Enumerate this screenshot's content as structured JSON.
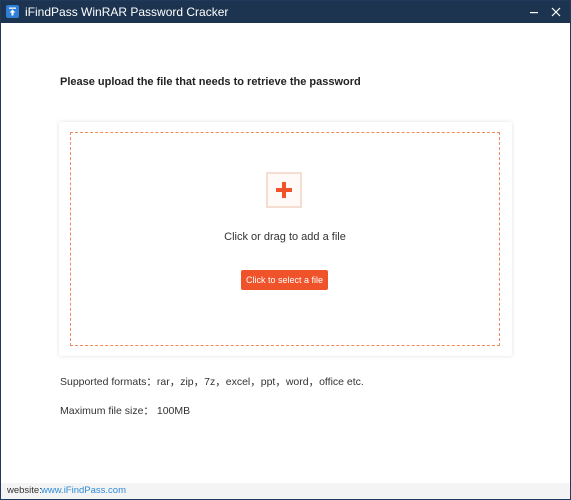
{
  "window": {
    "title": "iFindPass WinRAR Password Cracker",
    "icon": "app-icon"
  },
  "main": {
    "heading": "Please upload the file that needs to retrieve the password",
    "drop_text": "Click or drag to add a file",
    "select_button": "Click to select a file",
    "supported_formats": "Supported formats：rar，zip，7z，excel，ppt，word，office etc.",
    "max_file_size": "Maximum file size：  100MB"
  },
  "footer": {
    "label": "website:",
    "link": "www.iFindPass.com"
  },
  "colors": {
    "titlebar": "#1c3450",
    "accent": "#f0532a",
    "dashed_border": "#f08a5d",
    "link": "#2d8ad8"
  }
}
